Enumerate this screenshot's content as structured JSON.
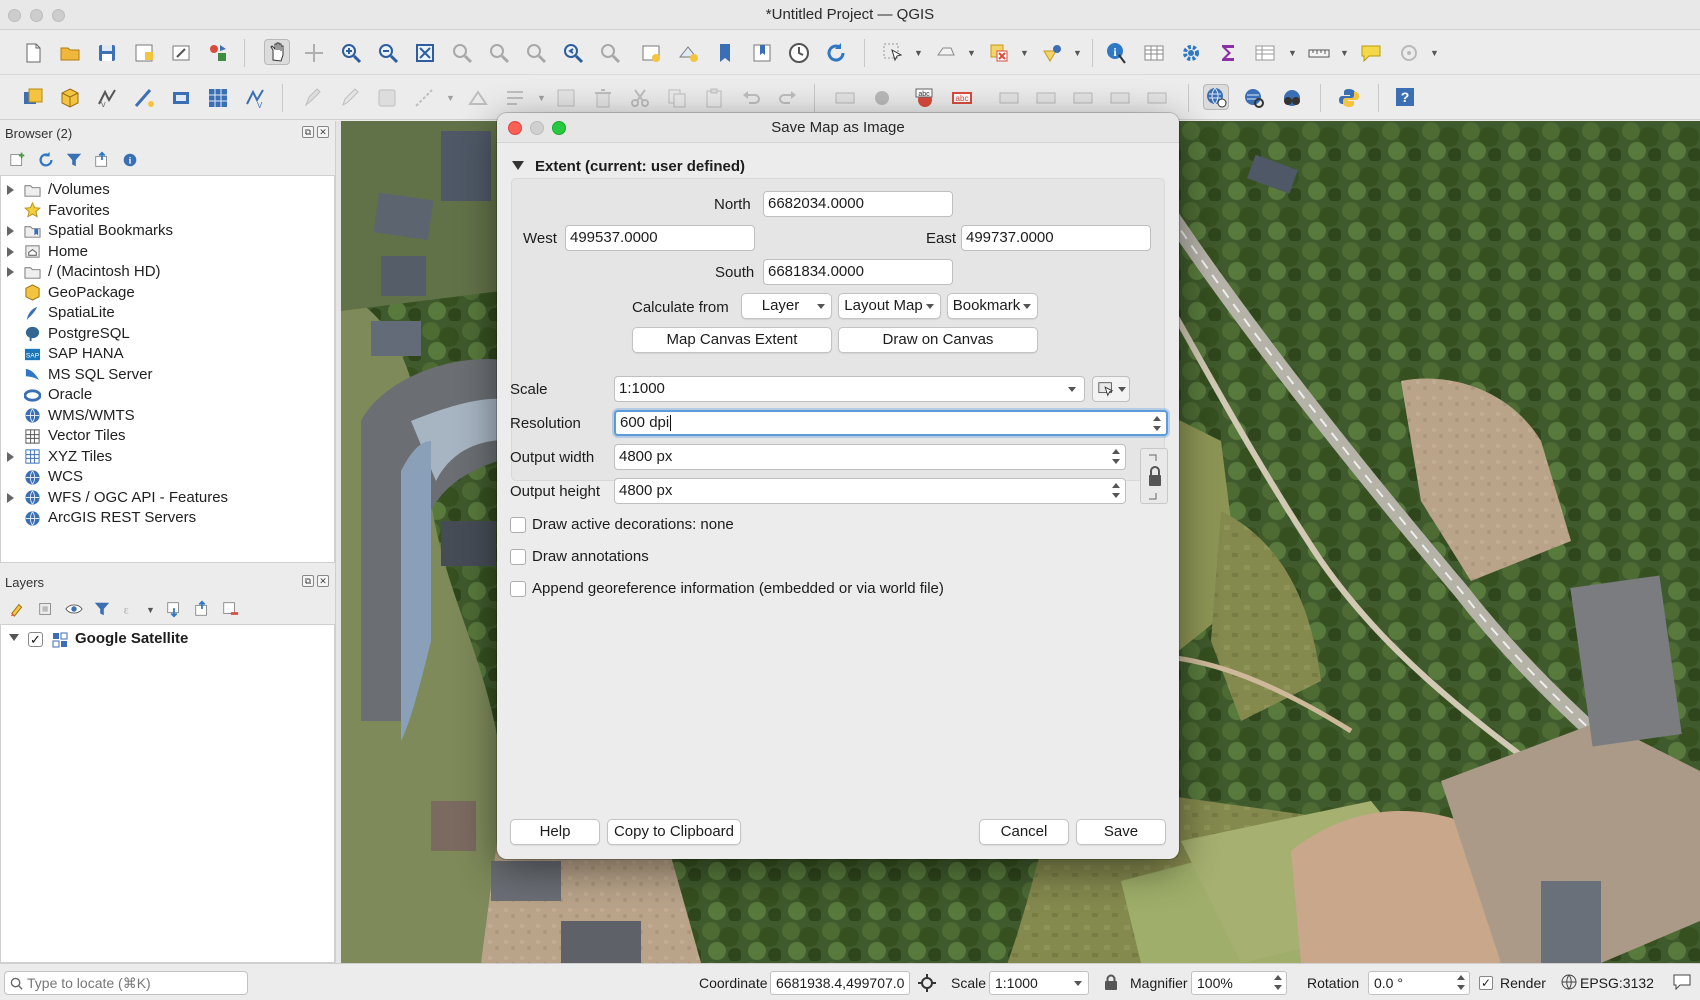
{
  "window": {
    "title": "*Untitled Project — QGIS"
  },
  "browser": {
    "title": "Browser (2)",
    "items": [
      {
        "label": "/Volumes",
        "icon": "folder-icon",
        "expandable": true
      },
      {
        "label": "Favorites",
        "icon": "star-icon",
        "expandable": false
      },
      {
        "label": "Spatial Bookmarks",
        "icon": "bookmark-folder-icon",
        "expandable": true
      },
      {
        "label": "Home",
        "icon": "home-folder-icon",
        "expandable": true
      },
      {
        "label": "/ (Macintosh HD)",
        "icon": "folder-icon",
        "expandable": true
      },
      {
        "label": "GeoPackage",
        "icon": "geopackage-icon",
        "expandable": false
      },
      {
        "label": "SpatiaLite",
        "icon": "spatialite-icon",
        "expandable": false
      },
      {
        "label": "PostgreSQL",
        "icon": "postgresql-icon",
        "expandable": false
      },
      {
        "label": "SAP HANA",
        "icon": "sap-hana-icon",
        "expandable": false
      },
      {
        "label": "MS SQL Server",
        "icon": "mssql-icon",
        "expandable": false
      },
      {
        "label": "Oracle",
        "icon": "oracle-icon",
        "expandable": false
      },
      {
        "label": "WMS/WMTS",
        "icon": "wms-globe-icon",
        "expandable": false
      },
      {
        "label": "Vector Tiles",
        "icon": "vector-tiles-icon",
        "expandable": false
      },
      {
        "label": "XYZ Tiles",
        "icon": "xyz-tiles-icon",
        "expandable": true
      },
      {
        "label": "WCS",
        "icon": "wcs-globe-icon",
        "expandable": false
      },
      {
        "label": "WFS / OGC API - Features",
        "icon": "wfs-globe-icon",
        "expandable": true
      },
      {
        "label": "ArcGIS REST Servers",
        "icon": "arcgis-globe-icon",
        "expandable": false
      }
    ]
  },
  "layers": {
    "title": "Layers",
    "items": [
      {
        "label": "Google Satellite",
        "checked": true,
        "icon": "raster-tiles-icon"
      }
    ]
  },
  "dialog": {
    "title": "Save Map as Image",
    "extent": {
      "header": "Extent (current: user defined)",
      "north_label": "North",
      "north_value": "6682034.0000",
      "west_label": "West",
      "west_value": "499537.0000",
      "east_label": "East",
      "east_value": "499737.0000",
      "south_label": "South",
      "south_value": "6681834.0000",
      "calc_label": "Calculate from",
      "layer_button": "Layer",
      "layout_map_button": "Layout Map",
      "bookmark_button": "Bookmark",
      "map_canvas_extent_button": "Map Canvas Extent",
      "draw_on_canvas_button": "Draw on Canvas"
    },
    "scale_label": "Scale",
    "scale_value": "1:1000",
    "resolution_label": "Resolution",
    "resolution_value": "600 dpi",
    "width_label": "Output width",
    "width_value": "4800 px",
    "height_label": "Output height",
    "height_value": "4800 px",
    "checkboxes": [
      {
        "label": "Draw active decorations: none",
        "checked": false
      },
      {
        "label": "Draw annotations",
        "checked": false
      },
      {
        "label": "Append georeference information (embedded or via world file)",
        "checked": false
      }
    ],
    "help_button": "Help",
    "copy_button": "Copy to Clipboard",
    "cancel_button": "Cancel",
    "save_button": "Save"
  },
  "statusbar": {
    "locate_placeholder": "Type to locate (⌘K)",
    "coordinate_label": "Coordinate",
    "coordinate_value": "6681938.4,499707.0",
    "scale_label": "Scale",
    "scale_value": "1:1000",
    "magnifier_label": "Magnifier",
    "magnifier_value": "100%",
    "rotation_label": "Rotation",
    "rotation_value": "0.0 °",
    "render_label": "Render",
    "render_checked": true,
    "crs_label": "EPSG:3132"
  },
  "colors": {
    "accent": "#5b9bd9",
    "close": "#fe5f57",
    "minimize": "#c9c9c9",
    "zoom": "#28c840"
  }
}
